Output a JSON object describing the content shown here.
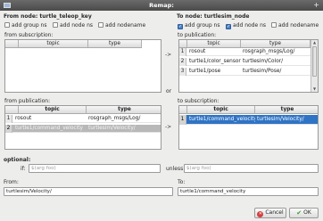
{
  "window": {
    "title": "Remap:",
    "close": "+"
  },
  "from": {
    "title": "From node: turtle_teleop_key",
    "options": [
      {
        "label": "add group ns",
        "checked": false
      },
      {
        "label": "add node ns",
        "checked": false
      },
      {
        "label": "add nodename",
        "checked": false
      }
    ],
    "subscription_label": "from subscription:",
    "subscription_headers": [
      "topic",
      "type"
    ],
    "publication_label": "from publication:",
    "publication_headers": [
      "topic",
      "type"
    ],
    "publication_rows": [
      {
        "num": "1",
        "topic": "rosout",
        "type": "rosgraph_msgs/Log/"
      },
      {
        "num": "2",
        "topic": "turtle1/command_velocity",
        "type": "turtlesim/Velocity/"
      }
    ]
  },
  "to": {
    "title": "To node: turtlesim_node",
    "options": [
      {
        "label": "add group ns",
        "checked": true
      },
      {
        "label": "add node ns",
        "checked": true
      },
      {
        "label": "add nodename",
        "checked": false
      }
    ],
    "publication_label": "to publication:",
    "publication_headers": [
      "topic",
      "type"
    ],
    "publication_rows": [
      {
        "num": "1",
        "topic": "rosout",
        "type": "rosgraph_msgs/Log/"
      },
      {
        "num": "2",
        "topic": "turtle1/color_sensor",
        "type": "turtlesim/Color/"
      },
      {
        "num": "3",
        "topic": "turtle1/pose",
        "type": "turtlesim/Pose/"
      }
    ],
    "subscription_label": "to subscription:",
    "subscription_headers": [
      "topic",
      "type"
    ],
    "subscription_rows": [
      {
        "num": "1",
        "topic": "turtle1/command_velocity",
        "type": "turtlesim/Velocity/"
      }
    ]
  },
  "arrow": "->",
  "or_label": "or",
  "optional": {
    "title": "optional:",
    "if_label": "if:",
    "if_placeholder": "$(arg foo)",
    "unless_label": "unless:",
    "unless_placeholder": "$(arg foo)"
  },
  "from_field": {
    "label": "From:",
    "value": "turtlesim/Velocity/"
  },
  "to_field": {
    "label": "To:",
    "value": "turtle1/command_velocity"
  },
  "buttons": {
    "cancel": "Cancel",
    "ok": "OK"
  },
  "colors": {
    "selection": "#2f73c4",
    "titlebar": "#555555"
  },
  "icons": {
    "cancel": "cancel-icon",
    "ok": "check-icon"
  }
}
